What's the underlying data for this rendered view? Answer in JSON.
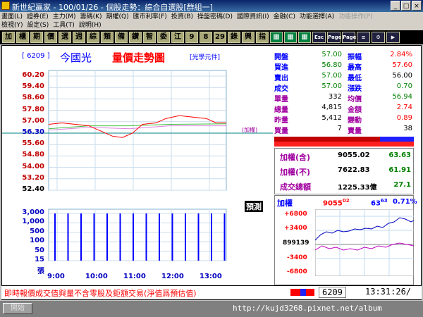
{
  "window": {
    "title": "新世紀贏家 - 100/01/26 - 個股走勢：綜合自選股[群組一]",
    "minimize": "_",
    "maximize": "□",
    "close": "×"
  },
  "menu": {
    "row1": [
      {
        "label": "畫面(L)",
        "enabled": true
      },
      {
        "label": "證券(E)",
        "enabled": true
      },
      {
        "label": "主力(M)",
        "enabled": true
      },
      {
        "label": "籌碼(K)",
        "enabled": true
      },
      {
        "label": "期權(Q)",
        "enabled": true
      },
      {
        "label": "匯市利率(F)",
        "enabled": true
      },
      {
        "label": "投資(B)",
        "enabled": true
      },
      {
        "label": "操盤密碼(D)",
        "enabled": true
      },
      {
        "label": "國際資訊(I)",
        "enabled": true
      },
      {
        "label": "金融(C)",
        "enabled": true
      },
      {
        "label": "功能選擇(A)",
        "enabled": true
      },
      {
        "label": "功能操作(P)",
        "enabled": false
      }
    ],
    "row2": [
      {
        "label": "檢視(Y)",
        "enabled": true
      },
      {
        "label": "設定(S)",
        "enabled": true
      },
      {
        "label": "工具(T)",
        "enabled": true
      },
      {
        "label": "說明(H)",
        "enabled": true
      }
    ]
  },
  "toolbar": [
    {
      "label": "加",
      "style": "normal"
    },
    {
      "label": "櫃",
      "style": "normal"
    },
    {
      "label": "期",
      "style": "normal"
    },
    {
      "label": "價",
      "style": "normal"
    },
    {
      "label": "選",
      "style": "normal"
    },
    {
      "label": "週",
      "style": "normal"
    },
    {
      "label": "綜",
      "style": "normal"
    },
    {
      "label": "類",
      "style": "normal"
    },
    {
      "label": "備",
      "style": "normal"
    },
    {
      "label": "鑽",
      "style": "normal"
    },
    {
      "label": "智",
      "style": "normal"
    },
    {
      "label": "委",
      "style": "normal"
    },
    {
      "label": "江",
      "style": "normal"
    },
    {
      "label": "9",
      "style": "normal"
    },
    {
      "label": "8",
      "style": "normal"
    },
    {
      "label": "29",
      "style": "normal"
    },
    {
      "label": "錄",
      "style": "normal"
    },
    {
      "label": "興",
      "style": "normal"
    },
    {
      "label": "指",
      "style": "normal"
    },
    {
      "label": "▦",
      "style": "green"
    },
    {
      "label": "▦",
      "style": "green"
    },
    {
      "label": "▦",
      "style": "green"
    },
    {
      "label": "Esc",
      "style": "dark"
    },
    {
      "label": "Page Up",
      "style": "dark"
    },
    {
      "label": "Page Dn",
      "style": "dark"
    },
    {
      "label": "≡",
      "style": "dark"
    },
    {
      "label": "⚙",
      "style": "dark"
    },
    {
      "label": "▶",
      "style": "dark"
    }
  ],
  "stock": {
    "code": "[ 6209 ]",
    "name": "今國光",
    "chart_title": "量價走勢圖",
    "unit": "[光學元件]",
    "weighted_label": "(加權)",
    "estimate_badge": "預測"
  },
  "quote": [
    {
      "l1": "開盤",
      "v1": "57.00",
      "c1": "green",
      "l2": "振幅",
      "v2": "2.84%",
      "c2": "red"
    },
    {
      "l1": "買進",
      "v1": "56.80",
      "c1": "green",
      "l2": "最高",
      "v2": "57.60",
      "c2": "red"
    },
    {
      "l1": "賣出",
      "v1": "57.00",
      "c1": "green",
      "l2": "最低",
      "v2": "56.00",
      "c2": "black"
    },
    {
      "l1": "成交",
      "v1": "57.00",
      "c1": "green",
      "l2": "漲跌",
      "v2": "0.70",
      "c2": "green"
    },
    {
      "l1": "單量",
      "v1": "332",
      "c1": "black",
      "l2": "均價",
      "v2": "56.94",
      "c2": "green"
    },
    {
      "l1": "總量",
      "v1": "4,815",
      "c1": "black",
      "l2": "金額",
      "v2": "2.74",
      "c2": "red"
    },
    {
      "l1": "昨量",
      "v1": "5,412",
      "c1": "black",
      "l2": "變動",
      "v2": "0.89",
      "c2": "red"
    },
    {
      "l1": "買量",
      "v1": "7",
      "c1": "black",
      "l2": "賣量",
      "v2": "38",
      "c2": "black"
    }
  ],
  "index": [
    {
      "label": "加權(含)",
      "value": "9055.02",
      "chg": "63.63"
    },
    {
      "label": "加權(不)",
      "value": "7622.83",
      "chg": "61.91"
    },
    {
      "label": "成交總額",
      "value": "1225.33億",
      "chg": "27.1"
    }
  ],
  "mini": {
    "label": "加權",
    "value": "9055",
    "value_frac": "02",
    "chg": "63",
    "chg_frac": "63",
    "pct": "0.71%",
    "mid": "899139",
    "y_up": [
      "+6800",
      "+3400"
    ],
    "y_dn": [
      "-3400",
      "-6800"
    ]
  },
  "status": {
    "message": "即時報價成交值與量不含零股及鉅額交易(淨值爲預估值)",
    "code": "6209",
    "time": "13:31:26/"
  },
  "taskbar": {
    "start": "開始",
    "tray": "http://kujd3268.pixnet.net/album"
  },
  "chart_data": {
    "type": "line",
    "x": [
      "9:00",
      "10:00",
      "11:00",
      "12:00",
      "13:00"
    ],
    "price_axis": [
      "60.20",
      "59.40",
      "58.60",
      "57.80",
      "57.00",
      "56.30",
      "55.60",
      "54.80",
      "54.00",
      "53.20",
      "52.40"
    ],
    "volume_axis": [
      "3,000",
      "1,000",
      "500",
      "100",
      "50",
      "15",
      "張"
    ],
    "ylim": [
      52.4,
      60.2
    ],
    "ref_price": 56.3,
    "price": [
      [
        0,
        56.9
      ],
      [
        20,
        57.0
      ],
      [
        40,
        56.9
      ],
      [
        60,
        56.8
      ],
      [
        80,
        56.4
      ],
      [
        95,
        56.1
      ],
      [
        110,
        56.0
      ],
      [
        125,
        56.3
      ],
      [
        140,
        56.9
      ],
      [
        160,
        57.0
      ],
      [
        175,
        57.3
      ],
      [
        195,
        57.5
      ],
      [
        215,
        57.4
      ],
      [
        235,
        57.3
      ],
      [
        250,
        57.0
      ],
      [
        265,
        57.0
      ]
    ],
    "avg": [
      [
        0,
        56.6
      ],
      [
        60,
        56.8
      ],
      [
        120,
        56.8
      ],
      [
        180,
        56.9
      ],
      [
        265,
        56.94
      ]
    ],
    "weighted": [
      [
        0,
        56.5
      ],
      [
        60,
        56.7
      ],
      [
        120,
        56.6
      ],
      [
        180,
        56.8
      ],
      [
        265,
        56.8
      ]
    ],
    "volume_bars": [
      100,
      100,
      100,
      100,
      100,
      100,
      100,
      100,
      100,
      100,
      100,
      100,
      100,
      100
    ]
  }
}
